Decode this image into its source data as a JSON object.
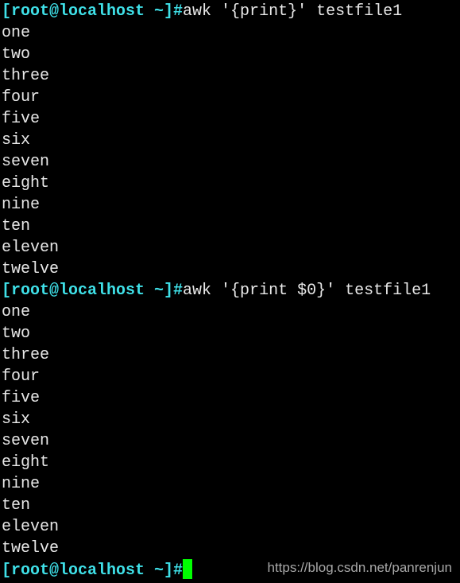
{
  "terminal": {
    "prompt": "[root@localhost ~]#",
    "lines": [
      {
        "prompt": true,
        "text": "awk '{print}' testfile1"
      },
      {
        "text": "one"
      },
      {
        "text": "two"
      },
      {
        "text": "three"
      },
      {
        "text": "four"
      },
      {
        "text": "five"
      },
      {
        "text": "six"
      },
      {
        "text": "seven"
      },
      {
        "text": "eight"
      },
      {
        "text": "nine"
      },
      {
        "text": "ten"
      },
      {
        "text": "eleven"
      },
      {
        "text": "twelve"
      },
      {
        "prompt": true,
        "text": "awk '{print $0}' testfile1"
      },
      {
        "text": "one"
      },
      {
        "text": "two"
      },
      {
        "text": "three"
      },
      {
        "text": "four"
      },
      {
        "text": "five"
      },
      {
        "text": "six"
      },
      {
        "text": "seven"
      },
      {
        "text": "eight"
      },
      {
        "text": "nine"
      },
      {
        "text": "ten"
      },
      {
        "text": "eleven"
      },
      {
        "text": "twelve"
      },
      {
        "prompt": true,
        "text": "",
        "cursor": true
      }
    ]
  },
  "colors": {
    "prompt": "#3fe0e8",
    "text": "#e8e8e8",
    "cursor": "#00ff00",
    "background": "#000000"
  },
  "watermark": "https://blog.csdn.net/panrenjun"
}
